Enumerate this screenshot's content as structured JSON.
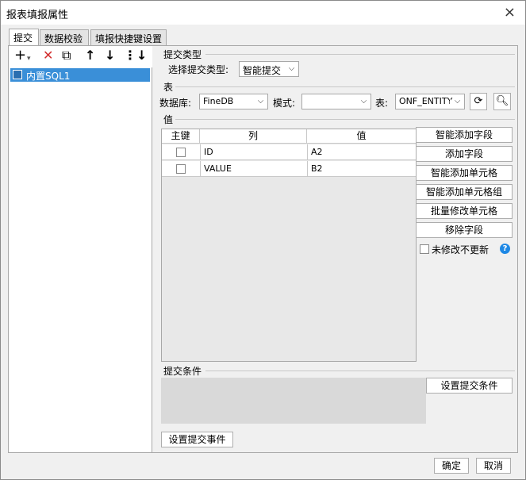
{
  "window": {
    "title": "报表填报属性",
    "close_icon": "×"
  },
  "tabs": [
    {
      "label": "提交"
    },
    {
      "label": "数据校验"
    },
    {
      "label": "填报快捷键设置"
    }
  ],
  "left": {
    "toolbar": {
      "add": "+",
      "add_arrow": "▾",
      "delete": "✕",
      "copy": "⧉",
      "up": "↑",
      "down": "↓",
      "more": "⋮↓"
    },
    "items": [
      {
        "label": "内置SQL1"
      }
    ]
  },
  "submit_type": {
    "section": "提交类型",
    "label": "选择提交类型:",
    "value": "智能提交"
  },
  "table_section": {
    "section": "表",
    "db_label": "数据库:",
    "db_value": "FineDB",
    "schema_label": "模式:",
    "schema_value": "",
    "table_label": "表:",
    "table_value": "ONF_ENTITY"
  },
  "value_section": {
    "section": "值",
    "columns": [
      "主键",
      "列",
      "值"
    ],
    "rows": [
      {
        "key": false,
        "col": "ID",
        "val": "A2"
      },
      {
        "key": false,
        "col": "VALUE",
        "val": "B2"
      }
    ],
    "buttons": {
      "smart_add_field": "智能添加字段",
      "add_field": "添加字段",
      "smart_add_cell": "智能添加单元格",
      "smart_add_cell_group": "智能添加单元格组",
      "batch_edit_cell": "批量修改单元格",
      "remove_field": "移除字段"
    },
    "no_update_label": "未修改不更新",
    "help_icon": "?"
  },
  "condition": {
    "section": "提交条件",
    "button": "设置提交条件"
  },
  "event_button": "设置提交事件",
  "footer": {
    "ok": "确定",
    "cancel": "取消"
  }
}
